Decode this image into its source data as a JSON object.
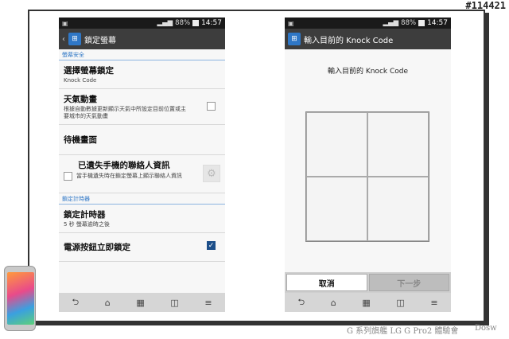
{
  "post_id": "#114421",
  "caption": "G 系列旗艦 LG G Pro2 體驗會",
  "caption_author": "Dosw",
  "status_bar": {
    "time": "14:57",
    "battery": "88%"
  },
  "left_screen": {
    "title": "鎖定螢幕",
    "section_security": "螢幕安全",
    "items": [
      {
        "title": "選擇螢幕鎖定",
        "sub": "Knock Code"
      },
      {
        "title": "天氣動畫",
        "sub": "根據自動數據更新顯示天氣中所設定目前位置或主要城市的天氣動畫"
      },
      {
        "title": "待機畫面",
        "sub": ""
      },
      {
        "title": "已遺失手機的聯絡人資訊",
        "sub": "當手機遺失時在鎖定螢幕上顯示聯絡人資訊"
      }
    ],
    "section_timer": "鎖定計時器",
    "timer_items": [
      {
        "title": "鎖定計時器",
        "sub": "5 秒 螢幕逾時之後"
      },
      {
        "title": "電源按鈕立即鎖定",
        "sub": ""
      }
    ]
  },
  "right_screen": {
    "title": "輸入目前的 Knock Code",
    "prompt": "輸入目前的 Knock Code",
    "cancel_label": "取消",
    "next_label": "下一步"
  },
  "nav_icons": [
    "back-icon",
    "home-icon",
    "dual-window-icon",
    "qslide-icon",
    "menu-icon"
  ]
}
